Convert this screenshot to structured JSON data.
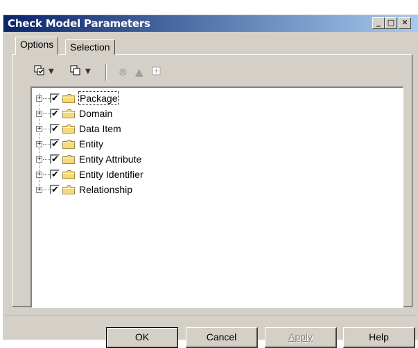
{
  "window": {
    "title": "Check Model Parameters",
    "minimize_glyph": "_",
    "maximize_glyph": "□",
    "close_glyph": "✕"
  },
  "tabs": [
    {
      "label": "Options",
      "active": true
    },
    {
      "label": "Selection",
      "active": false
    }
  ],
  "toolbar": {
    "icons": [
      "select-all-icon",
      "dropdown-arrow-icon",
      "deselect-all-icon",
      "dropdown-arrow-icon",
      "error-icon",
      "warning-icon",
      "expand-icon"
    ]
  },
  "tree": {
    "items": [
      {
        "label": "Package",
        "checked": true,
        "focused": true
      },
      {
        "label": "Domain",
        "checked": true
      },
      {
        "label": "Data Item",
        "checked": true
      },
      {
        "label": "Entity",
        "checked": true
      },
      {
        "label": "Entity Attribute",
        "checked": true
      },
      {
        "label": "Entity Identifier",
        "checked": true
      },
      {
        "label": "Relationship",
        "checked": true
      }
    ],
    "expander_glyph": "+",
    "check_glyph": "✔"
  },
  "buttons": {
    "ok": "OK",
    "cancel": "Cancel",
    "apply": "Apply",
    "help": "Help"
  },
  "colors": {
    "title_start": "#0a246a",
    "title_end": "#a6caf0",
    "face": "#d4d0c8",
    "folder": "#f5d97a"
  }
}
